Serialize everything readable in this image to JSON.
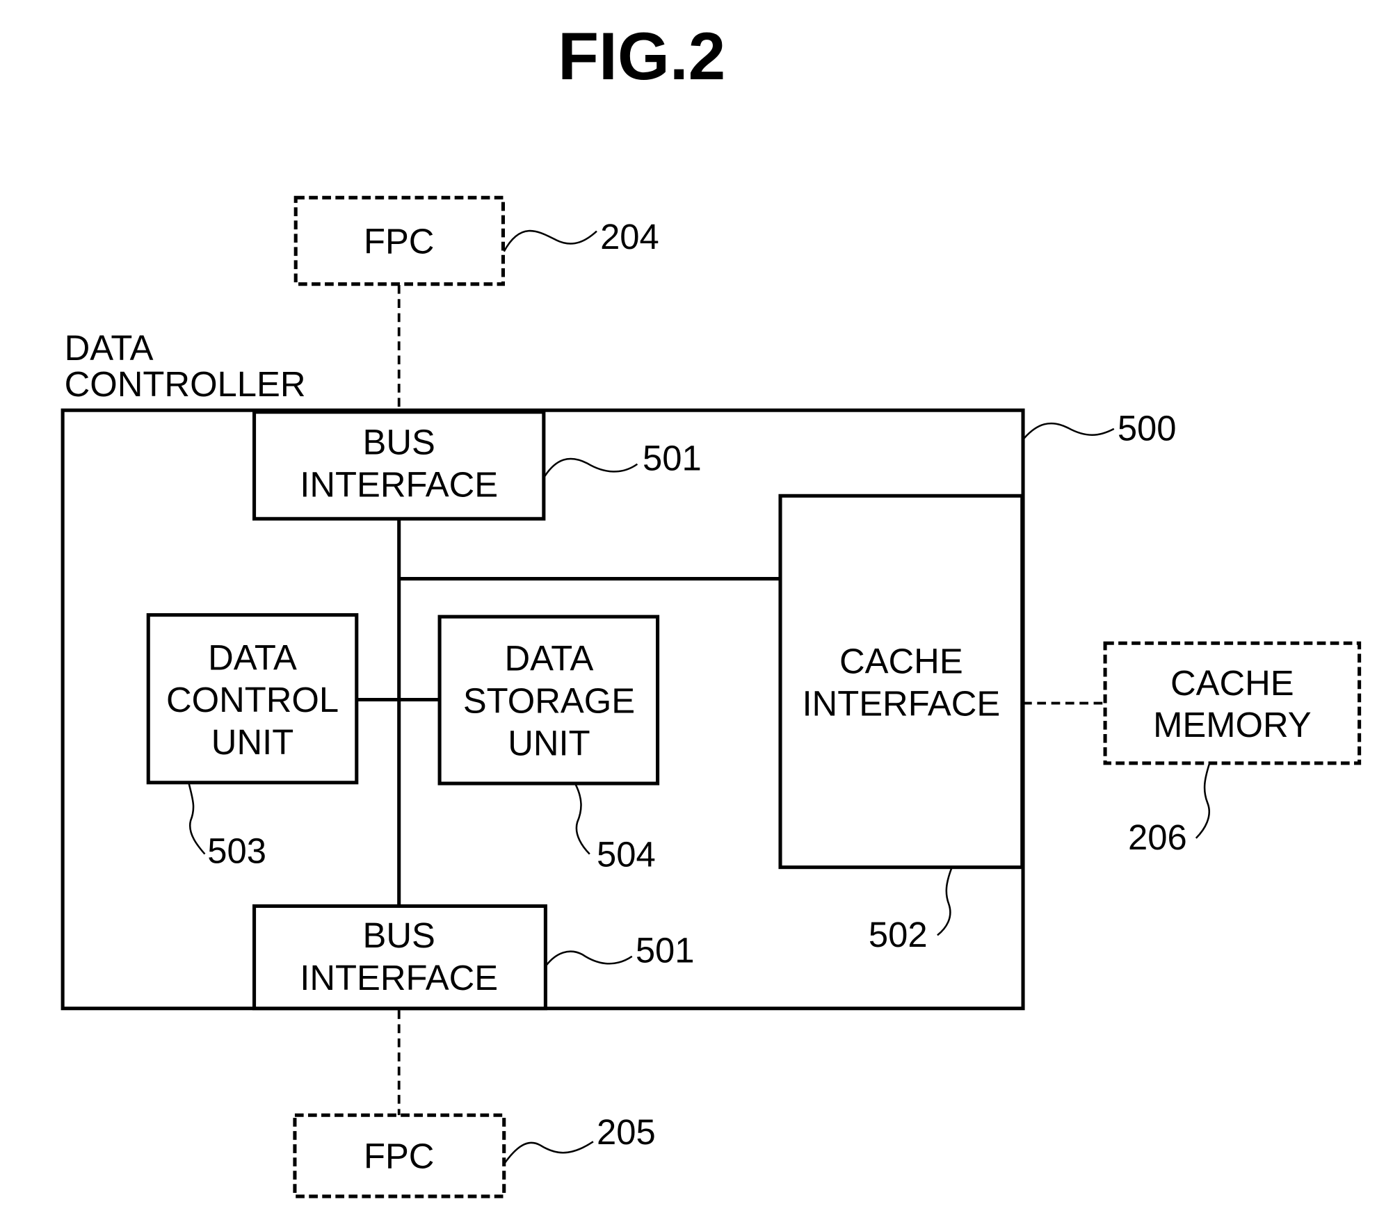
{
  "figure": {
    "title": "FIG.2"
  },
  "controller": {
    "label_line1": "DATA",
    "label_line2": "CONTROLLER",
    "ref": "500"
  },
  "blocks": {
    "fpc_top": {
      "label": "FPC",
      "ref": "204"
    },
    "fpc_bottom": {
      "label": "FPC",
      "ref": "205"
    },
    "bus_interface_top": {
      "line1": "BUS",
      "line2": "INTERFACE",
      "ref": "501"
    },
    "bus_interface_bottom": {
      "line1": "BUS",
      "line2": "INTERFACE",
      "ref": "501"
    },
    "data_control_unit": {
      "line1": "DATA",
      "line2": "CONTROL",
      "line3": "UNIT",
      "ref": "503"
    },
    "data_storage_unit": {
      "line1": "DATA",
      "line2": "STORAGE",
      "line3": "UNIT",
      "ref": "504"
    },
    "cache_interface": {
      "line1": "CACHE",
      "line2": "INTERFACE",
      "ref": "502"
    },
    "cache_memory": {
      "line1": "CACHE",
      "line2": "MEMORY",
      "ref": "206"
    }
  }
}
